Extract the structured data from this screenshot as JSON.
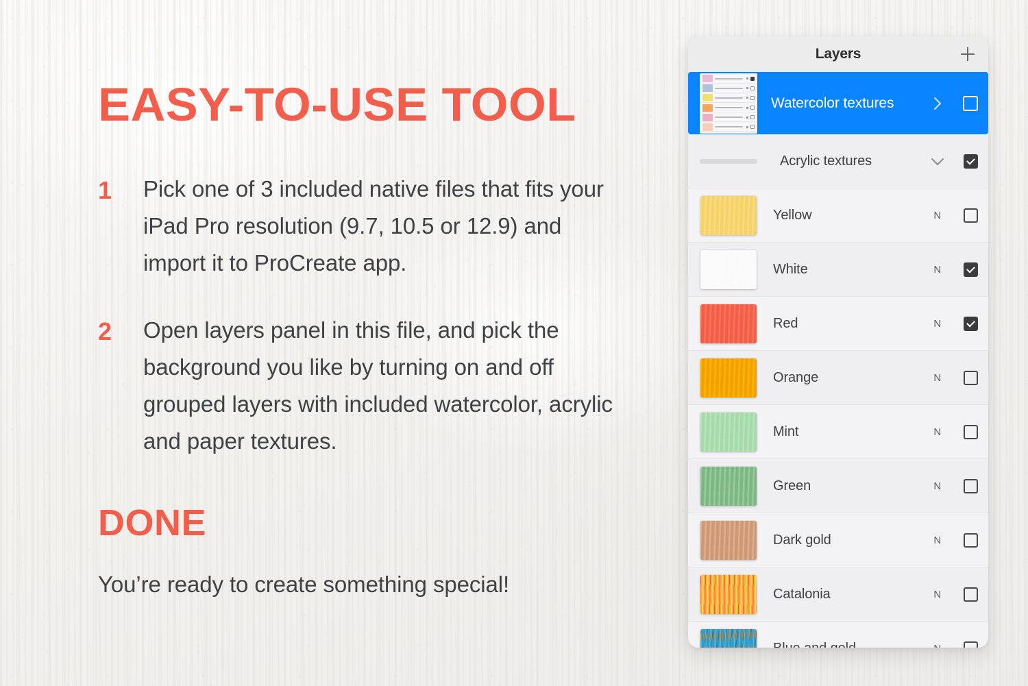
{
  "theme": {
    "accent_coral": "#f15f4c",
    "text_dark": "#3f4245",
    "selected_blue": "#0a84ff",
    "panel_bg": "#efeef0"
  },
  "promo": {
    "headline": "EASY-TO-USE TOOL",
    "steps": [
      {
        "number": "1",
        "text": "Pick one of 3 included native files that fits your iPad Pro resolution (9.7, 10.5 or 12.9) and import it to ProCreate app."
      },
      {
        "number": "2",
        "text": "Open layers panel in this file, and pick the background you like by turning on and off grouped layers with included watercolor, acrylic and paper textures."
      }
    ],
    "done_title": "DONE",
    "done_subtitle": "You’re ready to create something special!"
  },
  "layers_panel": {
    "title": "Layers",
    "add_icon": "plus-icon",
    "rows": [
      {
        "name": "Watercolor textures",
        "type": "group",
        "selected": true,
        "collapsed": true,
        "chevron_icon": "chevron-right-icon",
        "visible": false,
        "blend_mode": "",
        "thumb_kind": "group-stack",
        "thumb_colors": [
          "#e9b9d6",
          "#aec3d8",
          "#f3e06a",
          "#f5a65a",
          "#f0aec2",
          "#f7cfb4"
        ]
      },
      {
        "name": "Acrylic textures",
        "type": "group",
        "selected": false,
        "collapsed": false,
        "chevron_icon": "chevron-down-icon",
        "visible": true,
        "blend_mode": "",
        "thumb_kind": "bar",
        "thumb_colors": [
          "#d9d8dc"
        ]
      },
      {
        "name": "Yellow",
        "type": "layer",
        "blend_mode": "N",
        "visible": false,
        "thumb_kind": "solid",
        "thumb_colors": [
          "#f8d36a"
        ]
      },
      {
        "name": "White",
        "type": "layer",
        "blend_mode": "N",
        "visible": true,
        "thumb_kind": "solid",
        "thumb_colors": [
          "#fbfbfb"
        ]
      },
      {
        "name": "Red",
        "type": "layer",
        "blend_mode": "N",
        "visible": true,
        "thumb_kind": "solid",
        "thumb_colors": [
          "#f4604a"
        ]
      },
      {
        "name": "Orange",
        "type": "layer",
        "blend_mode": "N",
        "visible": false,
        "thumb_kind": "solid",
        "thumb_colors": [
          "#f5a200"
        ]
      },
      {
        "name": "Mint",
        "type": "layer",
        "blend_mode": "N",
        "visible": false,
        "thumb_kind": "solid",
        "thumb_colors": [
          "#a6dcac"
        ]
      },
      {
        "name": "Green",
        "type": "layer",
        "blend_mode": "N",
        "visible": false,
        "thumb_kind": "solid",
        "thumb_colors": [
          "#7fba85"
        ]
      },
      {
        "name": "Dark gold",
        "type": "layer",
        "blend_mode": "N",
        "visible": false,
        "thumb_kind": "solid",
        "thumb_colors": [
          "#d19a77"
        ]
      },
      {
        "name": "Catalonia",
        "type": "layer",
        "blend_mode": "N",
        "visible": false,
        "thumb_kind": "streak-warm",
        "thumb_colors": [
          "#f9a83c",
          "#ea4a28",
          "#fdd35e"
        ]
      },
      {
        "name": "Blue and gold",
        "type": "layer",
        "blend_mode": "N",
        "visible": false,
        "thumb_kind": "streak-cool",
        "thumb_colors": [
          "#2e9ad0",
          "#b98a4e",
          "#1b82bb"
        ]
      }
    ]
  }
}
